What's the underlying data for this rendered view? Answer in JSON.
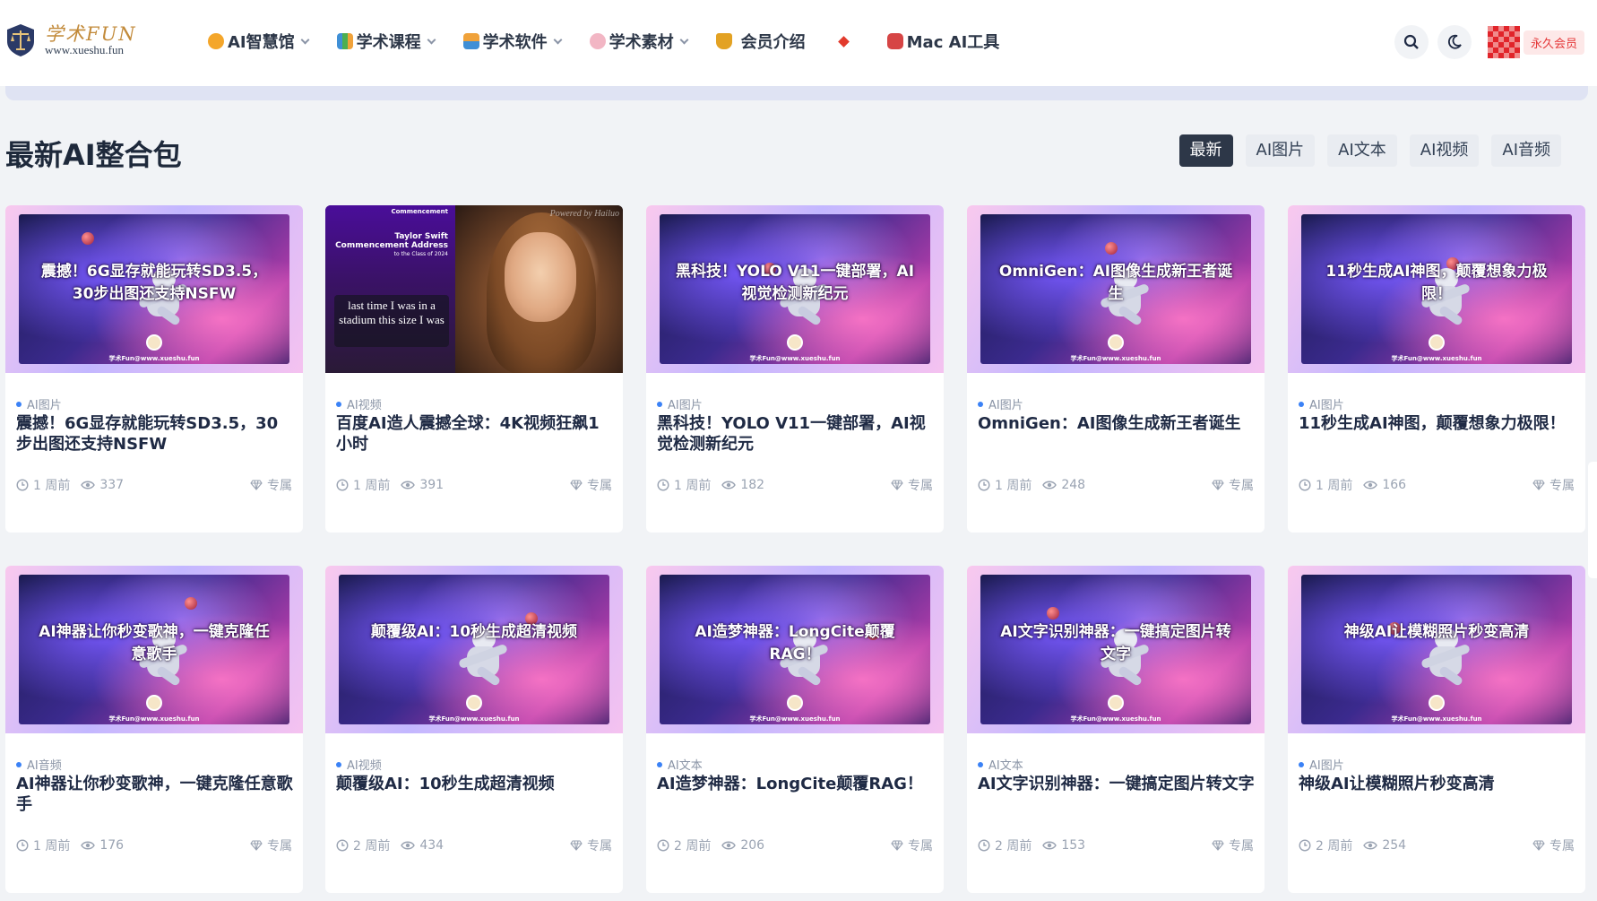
{
  "logo": {
    "cn": "学术FUN",
    "url": "www.xueshu.fun"
  },
  "nav": [
    {
      "label": "AI智慧馆",
      "icon": "smile-icon",
      "color": "#f4a62a",
      "dropdown": true
    },
    {
      "label": "学术课程",
      "icon": "books-icon",
      "color": "#3f8fd6",
      "dropdown": true
    },
    {
      "label": "学术软件",
      "icon": "user-icon",
      "color": "#f0a23a",
      "dropdown": true
    },
    {
      "label": "学术素材",
      "icon": "palette-icon",
      "color": "#e86a8a",
      "dropdown": true
    },
    {
      "label": "会员介绍",
      "icon": "trophy-icon",
      "color": "#e3a223",
      "dropdown": false
    },
    {
      "label": "",
      "icon": "red-diamond-icon",
      "color": "#e23a2c",
      "dropdown": false
    },
    {
      "label": "Mac AI工具",
      "icon": "robot-icon",
      "color": "#d64545",
      "dropdown": false
    }
  ],
  "header_right": {
    "vip_label": "永久会员"
  },
  "section": {
    "title": "最新AI整合包",
    "filters": [
      "最新",
      "AI图片",
      "AI文本",
      "AI视频",
      "AI音频"
    ],
    "active_filter": "最新"
  },
  "watermark": "学术Fun@www.xueshu.fun",
  "special_thumb": {
    "header_small": "Commencement",
    "header_name": "Taylor Swift",
    "header_line": "Commencement Address",
    "header_sub": "to the Class of 2024",
    "caption": "last time I was in a stadium this size I was",
    "powered": "Powered by Hailuo"
  },
  "cards": [
    {
      "thumb_title": "震撼！6G显存就能玩转SD3.5，30步出图还支持NSFW",
      "category": "AI图片",
      "title": "震撼！6G显存就能玩转SD3.5，30步出图还支持NSFW",
      "time": "1 周前",
      "views": "337",
      "tag": "专属"
    },
    {
      "thumb_title": "",
      "category": "AI视频",
      "title": "百度AI造人震撼全球：4K视频狂飙1小时",
      "time": "1 周前",
      "views": "391",
      "tag": "专属"
    },
    {
      "thumb_title": "黑科技！YOLO V11一键部署，AI视觉检测新纪元",
      "category": "AI图片",
      "title": "黑科技！YOLO V11一键部署，AI视觉检测新纪元",
      "time": "1 周前",
      "views": "182",
      "tag": "专属"
    },
    {
      "thumb_title": "OmniGen：AI图像生成新王者诞生",
      "category": "AI图片",
      "title": "OmniGen：AI图像生成新王者诞生",
      "time": "1 周前",
      "views": "248",
      "tag": "专属"
    },
    {
      "thumb_title": "11秒生成AI神图，颠覆想象力极限！",
      "category": "AI图片",
      "title": "11秒生成AI神图，颠覆想象力极限！",
      "time": "1 周前",
      "views": "166",
      "tag": "专属"
    },
    {
      "thumb_title": "AI神器让你秒变歌神，一键克隆任意歌手",
      "category": "AI音频",
      "title": "AI神器让你秒变歌神，一键克隆任意歌手",
      "time": "1 周前",
      "views": "176",
      "tag": "专属"
    },
    {
      "thumb_title": "颠覆级AI：10秒生成超清视频",
      "category": "AI视频",
      "title": "颠覆级AI：10秒生成超清视频",
      "time": "2 周前",
      "views": "434",
      "tag": "专属"
    },
    {
      "thumb_title": "AI造梦神器：LongCite颠覆RAG！",
      "category": "AI文本",
      "title": "AI造梦神器：LongCite颠覆RAG！",
      "time": "2 周前",
      "views": "206",
      "tag": "专属"
    },
    {
      "thumb_title": "AI文字识别神器：一键搞定图片转文字",
      "category": "AI文本",
      "title": "AI文字识别神器：一键搞定图片转文字",
      "time": "2 周前",
      "views": "153",
      "tag": "专属"
    },
    {
      "thumb_title": "神级AI让模糊照片秒变高清",
      "category": "AI图片",
      "title": "神级AI让模糊照片秒变高清",
      "time": "2 周前",
      "views": "254",
      "tag": "专属"
    }
  ]
}
